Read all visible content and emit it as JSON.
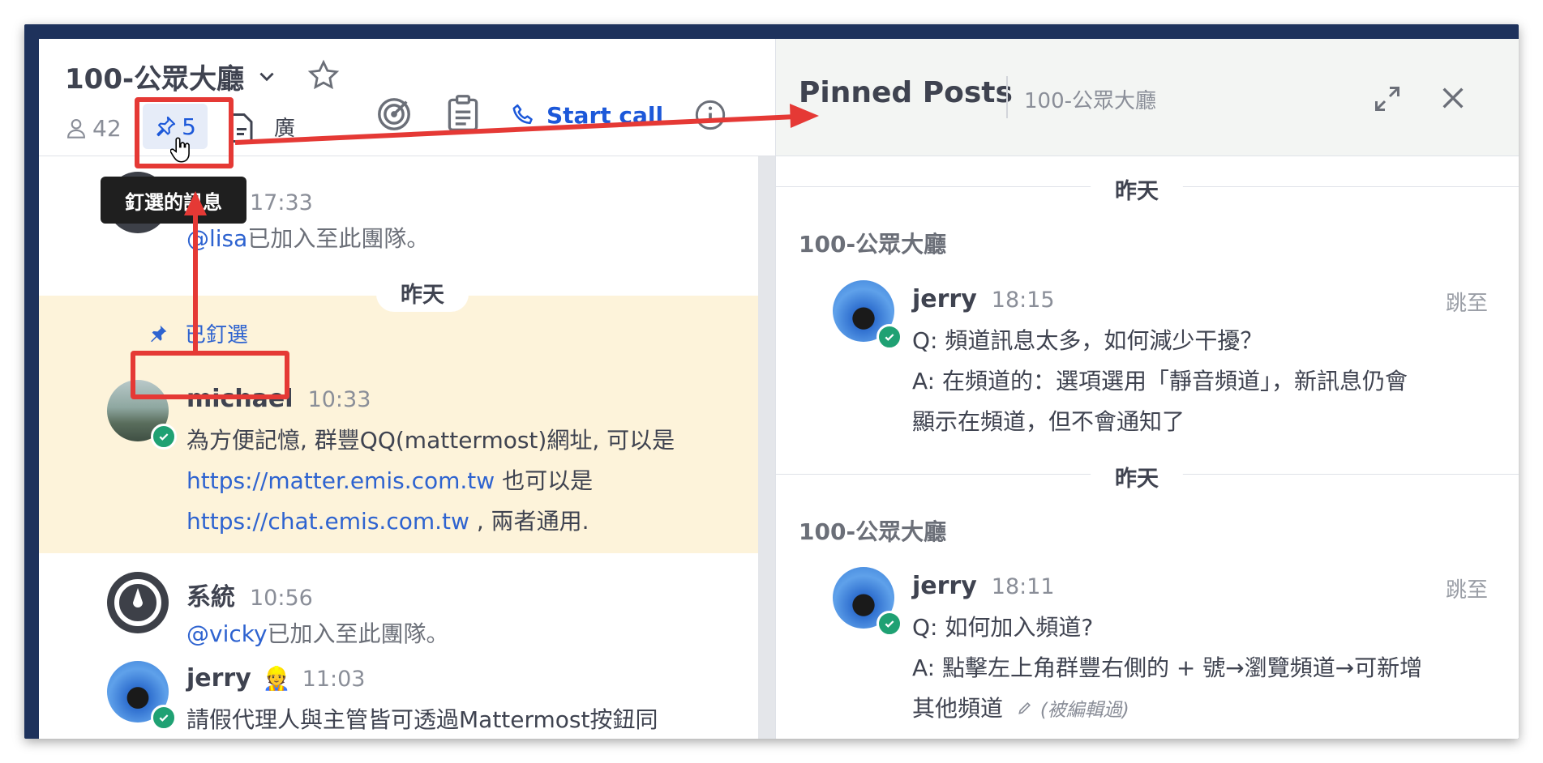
{
  "channel": {
    "title": "100-公眾大廳",
    "member_count": "42",
    "pinned_count": "5",
    "extra_text": "廣",
    "start_call_label": "Start call"
  },
  "tooltip": "釘選的訊息",
  "posts": {
    "p1": {
      "name": "系統",
      "time": "17:33",
      "mention": "@lisa",
      "text": "已加入至此團隊。"
    },
    "date_sep": "昨天",
    "pinned_label": "已釘選",
    "p2": {
      "name": "michael",
      "time": "10:33",
      "line1": "為方便記憶, 群豐QQ(mattermost)網址, 可以是",
      "link1": "https://matter.emis.com.tw",
      "line2_after": "也可以是",
      "link2": "https://chat.emis.com.tw",
      "line3_after": ", 兩者通用."
    },
    "p3": {
      "name": "系統",
      "time": "10:56",
      "mention": "@vicky",
      "text": "已加入至此團隊。"
    },
    "p4": {
      "name": "jerry",
      "emoji": "👷",
      "time": "11:03",
      "text": "請假代理人與主管皆可透過Mattermost按鈕同"
    }
  },
  "rhs": {
    "title": "Pinned Posts",
    "subtitle": "100-公眾大廳",
    "items": [
      {
        "date": "昨天",
        "channel": "100-公眾大廳",
        "name": "jerry",
        "time": "18:15",
        "jump": "跳至",
        "q": "Q: 頻道訊息太多，如何減少干擾？",
        "a1": "A: 在頻道的：選項選用「靜音頻道」，新訊息仍會",
        "a2": "顯示在頻道，但不會通知了"
      },
      {
        "date": "昨天",
        "channel": "100-公眾大廳",
        "name": "jerry",
        "time": "18:11",
        "jump": "跳至",
        "q": "Q: 如何加入頻道?",
        "a1": "A: 點擊左上角群豐右側的 + 號→瀏覽頻道→可新增",
        "a2": "其他頻道",
        "edited": "(被編輯過)"
      }
    ]
  },
  "colors": {
    "accent": "#1c58d9",
    "pinned_bg": "#fdf3da",
    "online": "#1fa173",
    "annotation": "#e53935",
    "frame": "#1e325c"
  }
}
